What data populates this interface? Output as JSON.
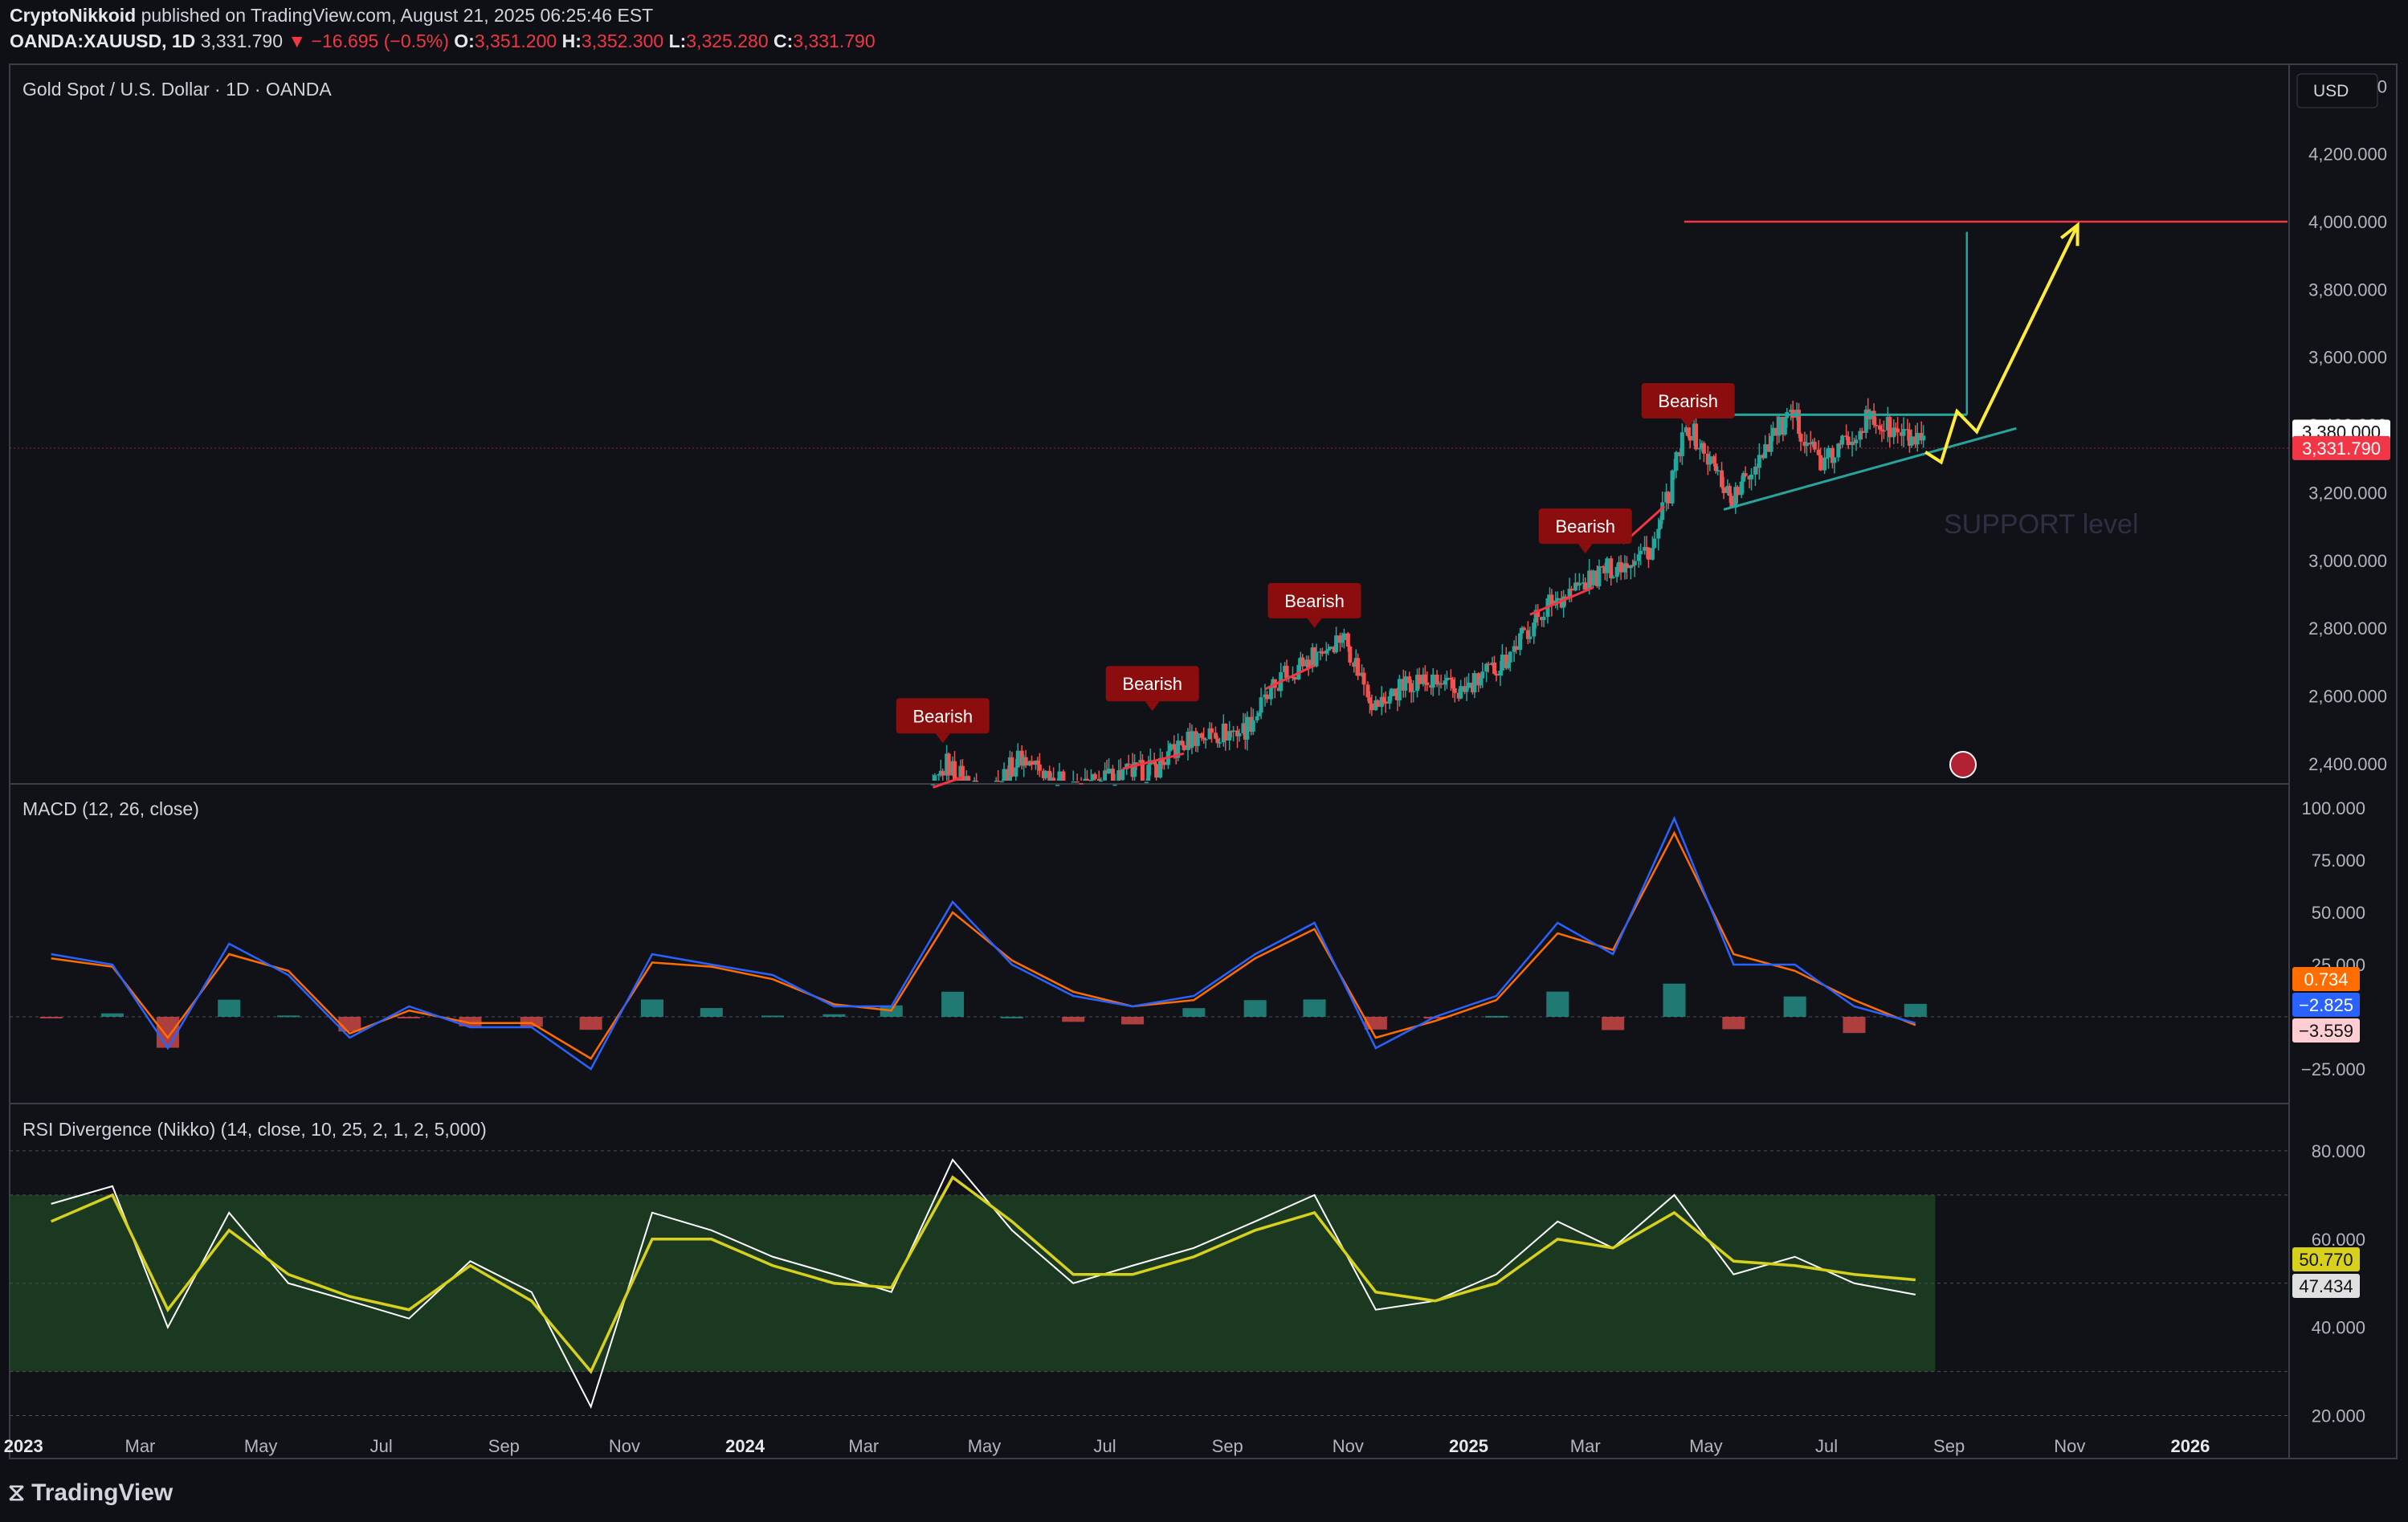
{
  "header": {
    "author": "CryptoNikkoid",
    "published": "published on TradingView.com, August 21, 2025 06:25:46 EST",
    "symbol": "OANDA:XAUUSD, 1D",
    "last": "3,331.790",
    "change": "▼ −16.695 (−0.5%)",
    "o_label": "O:",
    "o": "3,351.200",
    "h_label": "H:",
    "h": "3,352.300",
    "l_label": "L:",
    "l": "3,325.280",
    "c_label": "C:",
    "c": "3,331.790"
  },
  "panes": {
    "price_title": "Gold Spot / U.S. Dollar · 1D · OANDA",
    "currency": "USD",
    "macd_title": "MACD (12, 26, close)",
    "rsi_title": "RSI Divergence (Nikko) (14, close, 10, 25, 2, 1, 2, 5,000)"
  },
  "footer": {
    "brand": "TradingView"
  },
  "colors": {
    "bg": "#0f1015",
    "up": "#26a69a",
    "down": "#ef5350",
    "bearish": "#8b0d0d",
    "target": "#f23645",
    "arrow": "#ffeb3b",
    "macd": "#2962ff",
    "signal": "#ff6d00",
    "rsi": "#ffffff",
    "rsi_ma": "#d7d01c"
  },
  "chart_data": [
    {
      "type": "candlestick",
      "title": "Gold Spot / U.S. Dollar · 1D · OANDA",
      "x_ticks": [
        "2023",
        "Mar",
        "May",
        "Jul",
        "Sep",
        "Nov",
        "2024",
        "Mar",
        "May",
        "Jul",
        "Sep",
        "Nov",
        "2025",
        "Mar",
        "May",
        "Jul",
        "Sep",
        "Nov",
        "2026"
      ],
      "y_ticks": [
        "2,400.000",
        "2,600.000",
        "2,800.000",
        "3,000.000",
        "3,200.000",
        "3,400.000",
        "3,600.000",
        "3,800.000",
        "4,000.000",
        "4,200.000",
        "4,400.000"
      ],
      "ylim": [
        2345,
        4460
      ],
      "close_path": [
        [
          "2024-03-25",
          2180
        ],
        [
          "2024-04-12",
          2400
        ],
        [
          "2024-05-01",
          2300
        ],
        [
          "2024-05-20",
          2420
        ],
        [
          "2024-06-15",
          2320
        ],
        [
          "2024-07-10",
          2370
        ],
        [
          "2024-07-25",
          2380
        ],
        [
          "2024-08-15",
          2480
        ],
        [
          "2024-09-10",
          2500
        ],
        [
          "2024-09-30",
          2660
        ],
        [
          "2024-10-30",
          2780
        ],
        [
          "2024-11-15",
          2570
        ],
        [
          "2024-12-05",
          2650
        ],
        [
          "2024-12-30",
          2610
        ],
        [
          "2025-01-20",
          2710
        ],
        [
          "2025-02-10",
          2870
        ],
        [
          "2025-02-25",
          2920
        ],
        [
          "2025-03-15",
          2980
        ],
        [
          "2025-04-05",
          3040
        ],
        [
          "2025-04-22",
          3400
        ],
        [
          "2025-05-15",
          3180
        ],
        [
          "2025-06-05",
          3380
        ],
        [
          "2025-06-15",
          3420
        ],
        [
          "2025-06-30",
          3280
        ],
        [
          "2025-07-22",
          3420
        ],
        [
          "2025-08-05",
          3380
        ],
        [
          "2025-08-20",
          3331.79
        ]
      ],
      "bearish_labels": [
        {
          "text": "Bearish",
          "date": "2024-04-10",
          "value": 2470
        },
        {
          "text": "Bearish",
          "date": "2024-07-25",
          "value": 2565
        },
        {
          "text": "Bearish",
          "date": "2024-10-15",
          "value": 2810
        },
        {
          "text": "Bearish",
          "date": "2025-03-01",
          "value": 3030
        },
        {
          "text": "Bearish",
          "date": "2025-04-22",
          "value": 3400
        }
      ],
      "price_labels": [
        {
          "value": "3,380.000"
        },
        {
          "value": "3,331.790"
        }
      ],
      "target": {
        "value": 4000,
        "from": "2025-04-20",
        "to": "2025-12-31"
      },
      "resistance": {
        "value": 3430,
        "from": "2025-04-22",
        "to": "2025-09-10"
      },
      "support_line": {
        "from": [
          "2025-05-10",
          3150
        ],
        "to": [
          "2025-10-05",
          3390
        ]
      },
      "annotation": "SUPPORT level",
      "projection": [
        [
          "2025-08-20",
          3320
        ],
        [
          "2025-08-28",
          3290
        ],
        [
          "2025-09-05",
          3440
        ],
        [
          "2025-09-15",
          3380
        ],
        [
          "2025-11-05",
          3990
        ]
      ],
      "measured_move": {
        "date": "2025-09-10",
        "from": 3430,
        "to": 3970
      }
    },
    {
      "type": "line",
      "title": "MACD (12, 26, close)",
      "y_ticks": [
        "100.000",
        "75.000",
        "50.000",
        "25.000",
        "−25.000"
      ],
      "ylim": [
        -40,
        110
      ],
      "x": [
        "2023-01",
        "2023-02",
        "2023-03",
        "2023-04",
        "2023-05",
        "2023-06",
        "2023-07",
        "2023-08",
        "2023-09",
        "2023-10",
        "2023-11",
        "2023-12",
        "2024-01",
        "2024-02",
        "2024-03",
        "2024-04",
        "2024-05",
        "2024-06",
        "2024-07",
        "2024-08",
        "2024-09",
        "2024-10",
        "2024-11",
        "2024-12",
        "2025-01",
        "2025-02",
        "2025-03",
        "2025-04",
        "2025-05",
        "2025-06",
        "2025-07",
        "2025-08"
      ],
      "series": [
        {
          "name": "MACD",
          "values": [
            30,
            25,
            -15,
            35,
            20,
            -10,
            5,
            -5,
            -5,
            -25,
            30,
            25,
            20,
            5,
            5,
            55,
            25,
            10,
            5,
            10,
            30,
            45,
            -15,
            0,
            10,
            45,
            30,
            95,
            25,
            25,
            5,
            -3
          ]
        },
        {
          "name": "Signal",
          "values": [
            28,
            24,
            -10,
            30,
            22,
            -8,
            3,
            -3,
            -3,
            -20,
            26,
            24,
            18,
            6,
            3,
            50,
            27,
            12,
            5,
            8,
            28,
            42,
            -10,
            -2,
            8,
            40,
            32,
            88,
            30,
            22,
            8,
            -4
          ]
        }
      ],
      "value_labels": [
        "0.734",
        "−2.825",
        "−3.559"
      ]
    },
    {
      "type": "line",
      "title": "RSI Divergence (Nikko) (14, close, 10, 25, 2, 1, 2, 5,000)",
      "y_ticks": [
        "80.000",
        "60.000",
        "40.000",
        "20.000"
      ],
      "ylim": [
        15,
        90
      ],
      "x": [
        "2023-01",
        "2023-02",
        "2023-03",
        "2023-04",
        "2023-05",
        "2023-06",
        "2023-07",
        "2023-08",
        "2023-09",
        "2023-10",
        "2023-11",
        "2023-12",
        "2024-01",
        "2024-02",
        "2024-03",
        "2024-04",
        "2024-05",
        "2024-06",
        "2024-07",
        "2024-08",
        "2024-09",
        "2024-10",
        "2024-11",
        "2024-12",
        "2025-01",
        "2025-02",
        "2025-03",
        "2025-04",
        "2025-05",
        "2025-06",
        "2025-07",
        "2025-08"
      ],
      "series": [
        {
          "name": "RSI",
          "values": [
            68,
            72,
            40,
            66,
            50,
            46,
            42,
            55,
            48,
            22,
            66,
            62,
            56,
            52,
            48,
            78,
            62,
            50,
            54,
            58,
            64,
            70,
            44,
            46,
            52,
            64,
            58,
            70,
            52,
            56,
            50,
            47.434
          ]
        },
        {
          "name": "RSI MA",
          "values": [
            64,
            70,
            44,
            62,
            52,
            47,
            44,
            54,
            46,
            30,
            60,
            60,
            54,
            50,
            49,
            74,
            64,
            52,
            52,
            56,
            62,
            66,
            48,
            46,
            50,
            60,
            58,
            66,
            55,
            54,
            52,
            50.77
          ]
        }
      ],
      "value_labels": [
        "50.770",
        "47.434"
      ]
    }
  ]
}
